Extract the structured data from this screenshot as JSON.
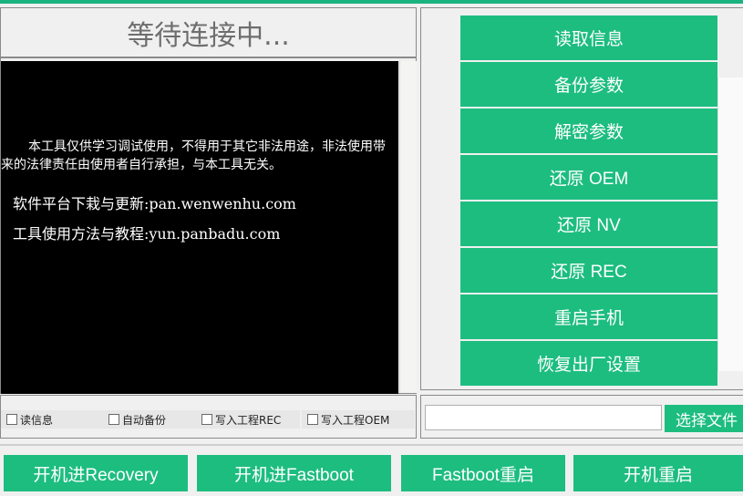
{
  "status": {
    "text": "等待连接中..."
  },
  "console": {
    "disclaimer": "本工具仅供学习调试使用，不得用于其它非法用途，非法使用带来的法律责任由使用者自行承担，与本工具无关。",
    "lines": [
      "软件平台下栽与更新:pan.wenwenhu.com",
      "工具使用方法与教程:yun.panbadu.com"
    ]
  },
  "options": [
    {
      "label": "读信息",
      "checked": false
    },
    {
      "label": "自动备份",
      "checked": false
    },
    {
      "label": "写入工程REC",
      "checked": false
    },
    {
      "label": "写入工程OEM",
      "checked": false
    }
  ],
  "actions": [
    "读取信息",
    "备份参数",
    "解密参数",
    "还原 OEM",
    "还原 NV",
    "还原 REC",
    "重启手机",
    "恢复出厂设置"
  ],
  "file": {
    "value": "",
    "choose_label": "选择文件"
  },
  "bottom": [
    "开机进Recovery",
    "开机进Fastboot",
    "Fastboot重启",
    "开机重启"
  ],
  "colors": {
    "accent": "#1dbd80",
    "console_bg": "#000000",
    "panel_bg": "#f0f0f0"
  }
}
